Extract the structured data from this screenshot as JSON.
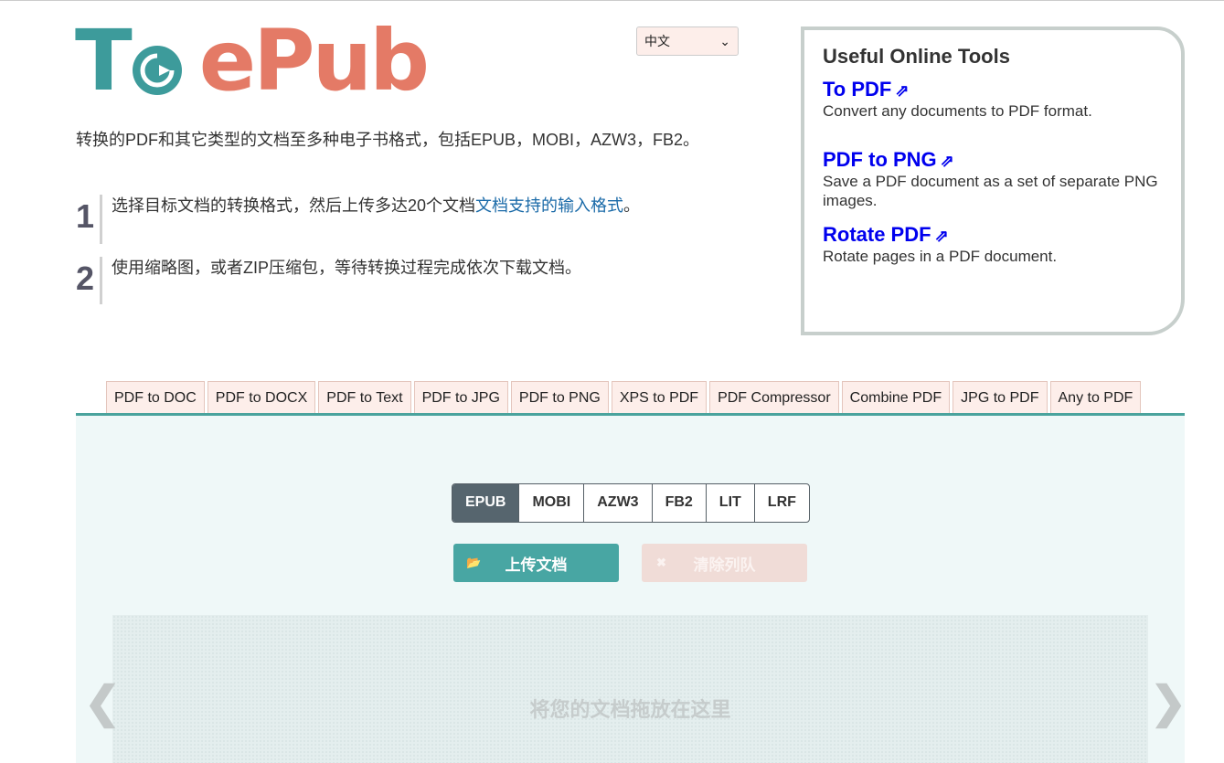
{
  "logo": {
    "part1": "T",
    "part2": "ePub"
  },
  "language": {
    "selected": "中文"
  },
  "tagline": "转换的PDF和其它类型的文档至多种电子书格式，包括EPUB，MOBI，AZW3，FB2。",
  "steps": [
    {
      "num": "1",
      "text": "选择目标文档的转换格式，然后上传多达20个文档",
      "link": "文档支持的输入格式",
      "suffix": "。"
    },
    {
      "num": "2",
      "text": "使用缩略图，或者ZIP压缩包，等待转换过程完成依次下载文档。"
    }
  ],
  "tools": {
    "title": "Useful Online Tools",
    "items": [
      {
        "name": "To PDF",
        "desc": "Convert any documents to PDF format."
      },
      {
        "name": "PDF to PNG",
        "desc": "Save a PDF document as a set of separate PNG images."
      },
      {
        "name": "Rotate PDF",
        "desc": "Rotate pages in a PDF document."
      }
    ]
  },
  "tabs": [
    "PDF to DOC",
    "PDF to DOCX",
    "PDF to Text",
    "PDF to JPG",
    "PDF to PNG",
    "XPS to PDF",
    "PDF Compressor",
    "Combine PDF",
    "JPG to PDF",
    "Any to PDF"
  ],
  "formats": [
    "EPUB",
    "MOBI",
    "AZW3",
    "FB2",
    "LIT",
    "LRF"
  ],
  "active_format": "EPUB",
  "buttons": {
    "upload": "上传文档",
    "clear": "清除列队"
  },
  "dropzone": {
    "text": "将您的文档拖放在这里"
  },
  "colors": {
    "teal": "#48a6a3",
    "orange": "#e47a66",
    "panel": "#eff8f8",
    "link": "#0000ee"
  }
}
